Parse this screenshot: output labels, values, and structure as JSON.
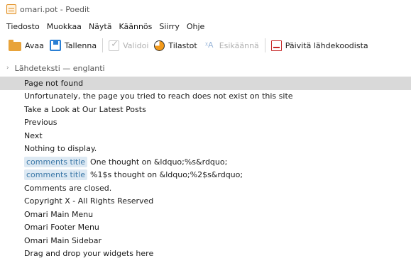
{
  "window": {
    "title": "omari.pot - Poedit"
  },
  "menu": [
    "Tiedosto",
    "Muokkaa",
    "Näytä",
    "Käännös",
    "Siirry",
    "Ohje"
  ],
  "toolbar": {
    "open": "Avaa",
    "save": "Tallenna",
    "validate": "Validoi",
    "stats": "Tilastot",
    "pretranslate": "Esikäännä",
    "update": "Päivitä lähdekoodista",
    "translate_glyph": "ᵡA"
  },
  "list": {
    "header": "Lähdeteksti — englanti",
    "header_chevron": "›",
    "rows": [
      {
        "text": "Page not found"
      },
      {
        "text": "Unfortunately, the page you tried to reach does not exist on this site"
      },
      {
        "text": "Take a Look at Our Latest Posts"
      },
      {
        "text": "Previous"
      },
      {
        "text": "Next"
      },
      {
        "text": "Nothing to display."
      },
      {
        "context": "comments title",
        "text": "One thought on &ldquo;%s&rdquo;"
      },
      {
        "context": "comments title",
        "text": "%1$s thought on &ldquo;%2$s&rdquo;"
      },
      {
        "text": "Comments are closed."
      },
      {
        "text": "Copyright X - All Rights Reserved"
      },
      {
        "text": "Omari Main Menu"
      },
      {
        "text": "Omari Footer Menu"
      },
      {
        "text": "Omari Main Sidebar"
      },
      {
        "text": "Drag and drop your widgets here"
      }
    ]
  }
}
